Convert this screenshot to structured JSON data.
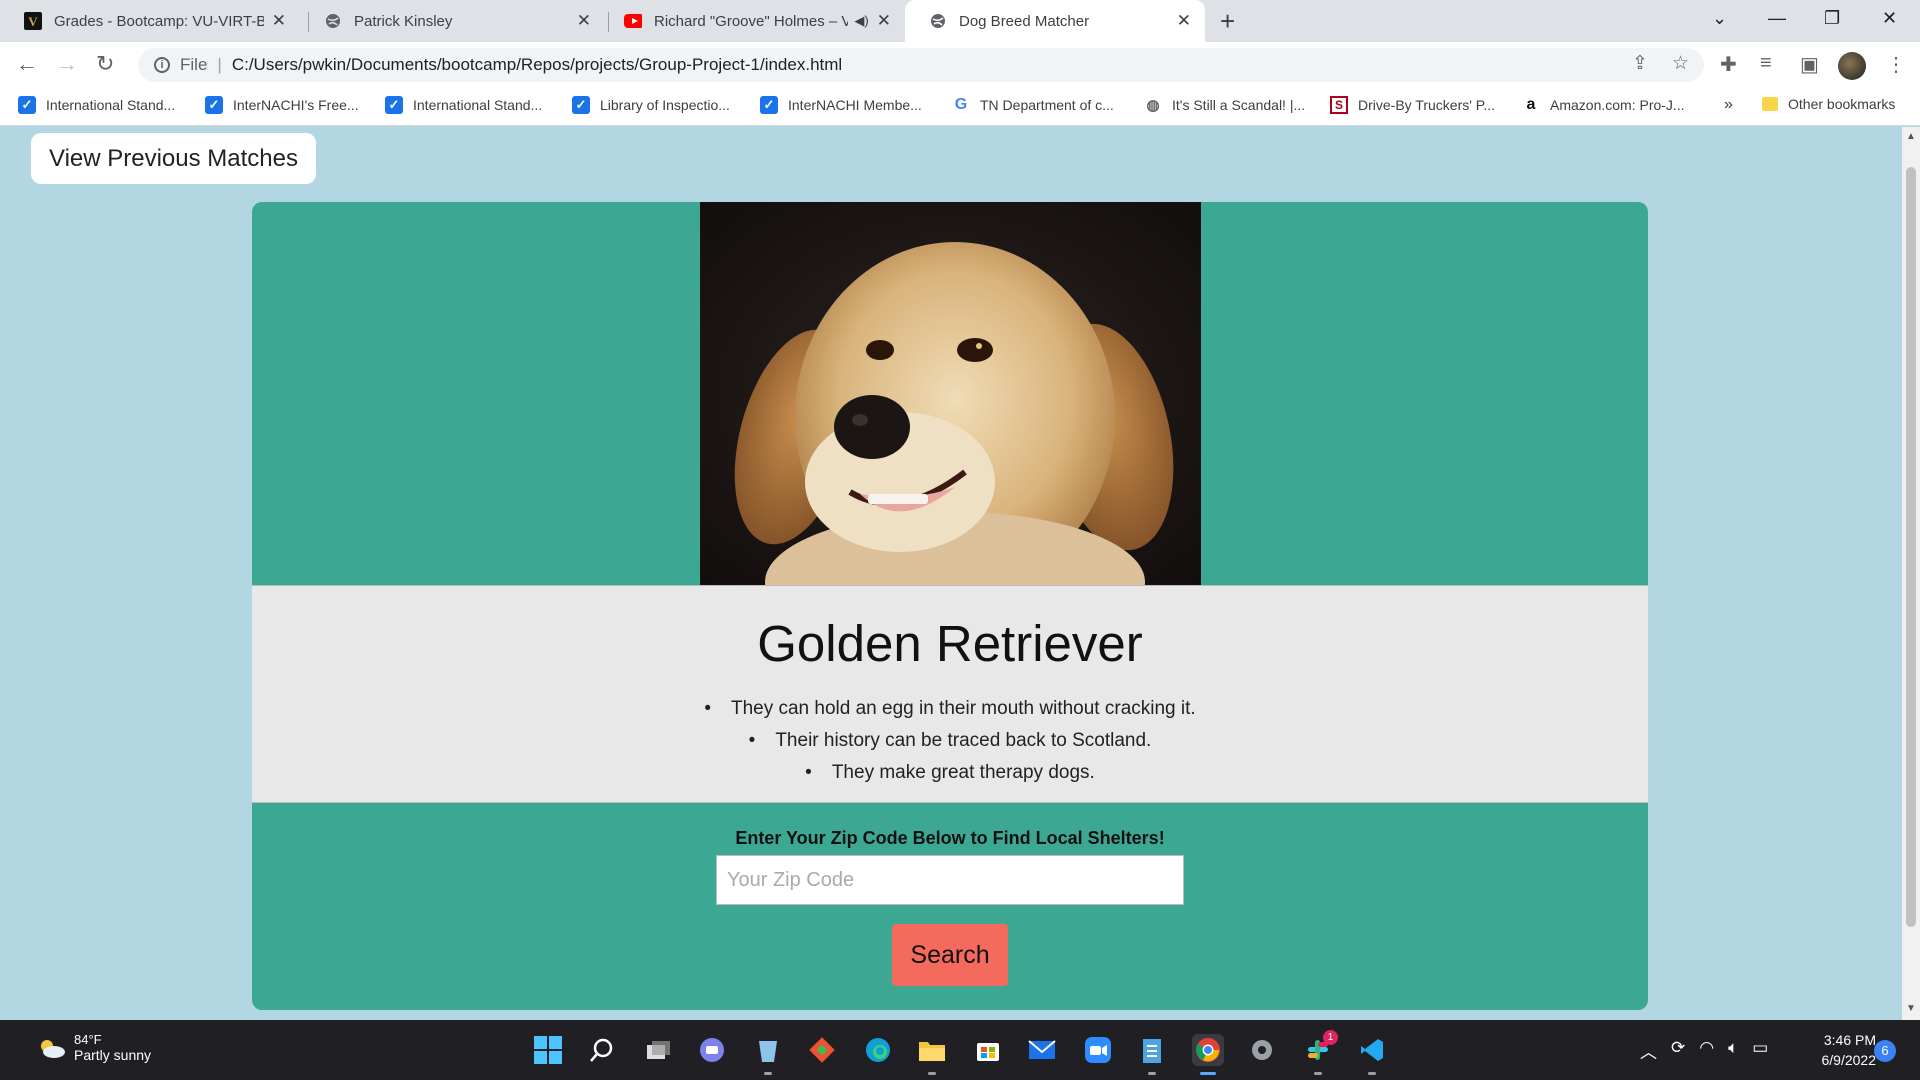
{
  "browser": {
    "tabs": [
      {
        "title": "Grades - Bootcamp: VU-VIRT-BO",
        "icon": "vanderbilt-icon"
      },
      {
        "title": "Patrick Kinsley",
        "icon": "globe-icon"
      },
      {
        "title": "Richard \"Groove\" Holmes – V",
        "icon": "youtube-icon"
      },
      {
        "title": "Dog Breed Matcher",
        "icon": "globe-icon"
      }
    ],
    "address": {
      "scheme": "File",
      "url": "C:/Users/pwkin/Documents/bootcamp/Repos/projects/Group-Project-1/index.html"
    },
    "bookmarks": [
      {
        "label": "International Stand...",
        "icon": "checkbox-icon"
      },
      {
        "label": "InterNACHI's Free...",
        "icon": "checkbox-icon"
      },
      {
        "label": "International Stand...",
        "icon": "checkbox-icon"
      },
      {
        "label": "Library of Inspectio...",
        "icon": "checkbox-icon"
      },
      {
        "label": "InterNACHI Membe...",
        "icon": "checkbox-icon"
      },
      {
        "label": "TN Department of c...",
        "icon": "google-icon"
      },
      {
        "label": "It's Still a Scandal! |...",
        "icon": "globe-icon"
      },
      {
        "label": "Drive-By Truckers' P...",
        "icon": "s-icon"
      },
      {
        "label": "Amazon.com: Pro-J...",
        "icon": "amazon-icon"
      }
    ],
    "bookmarks_more": "»",
    "other_bookmarks": "Other bookmarks"
  },
  "page": {
    "prev_matches_label": "View Previous Matches",
    "breed_name": "Golden Retriever",
    "facts": [
      "They can hold an egg in their mouth without cracking it.",
      "Their history can be traced back to Scotland.",
      "They make great therapy dogs."
    ],
    "zip_label": "Enter Your Zip Code Below to Find Local Shelters!",
    "zip_placeholder": "Your Zip Code",
    "zip_value": "",
    "search_label": "Search",
    "colors": {
      "background": "#b3d6e3",
      "card": "#3ca893",
      "info_panel": "#e8e8e8",
      "search_button": "#f46b5e"
    }
  },
  "taskbar": {
    "weather_temp": "84°F",
    "weather_condition": "Partly sunny",
    "time": "3:46 PM",
    "date": "6/9/2022",
    "notification_count": "6",
    "slack_badge": "1"
  }
}
